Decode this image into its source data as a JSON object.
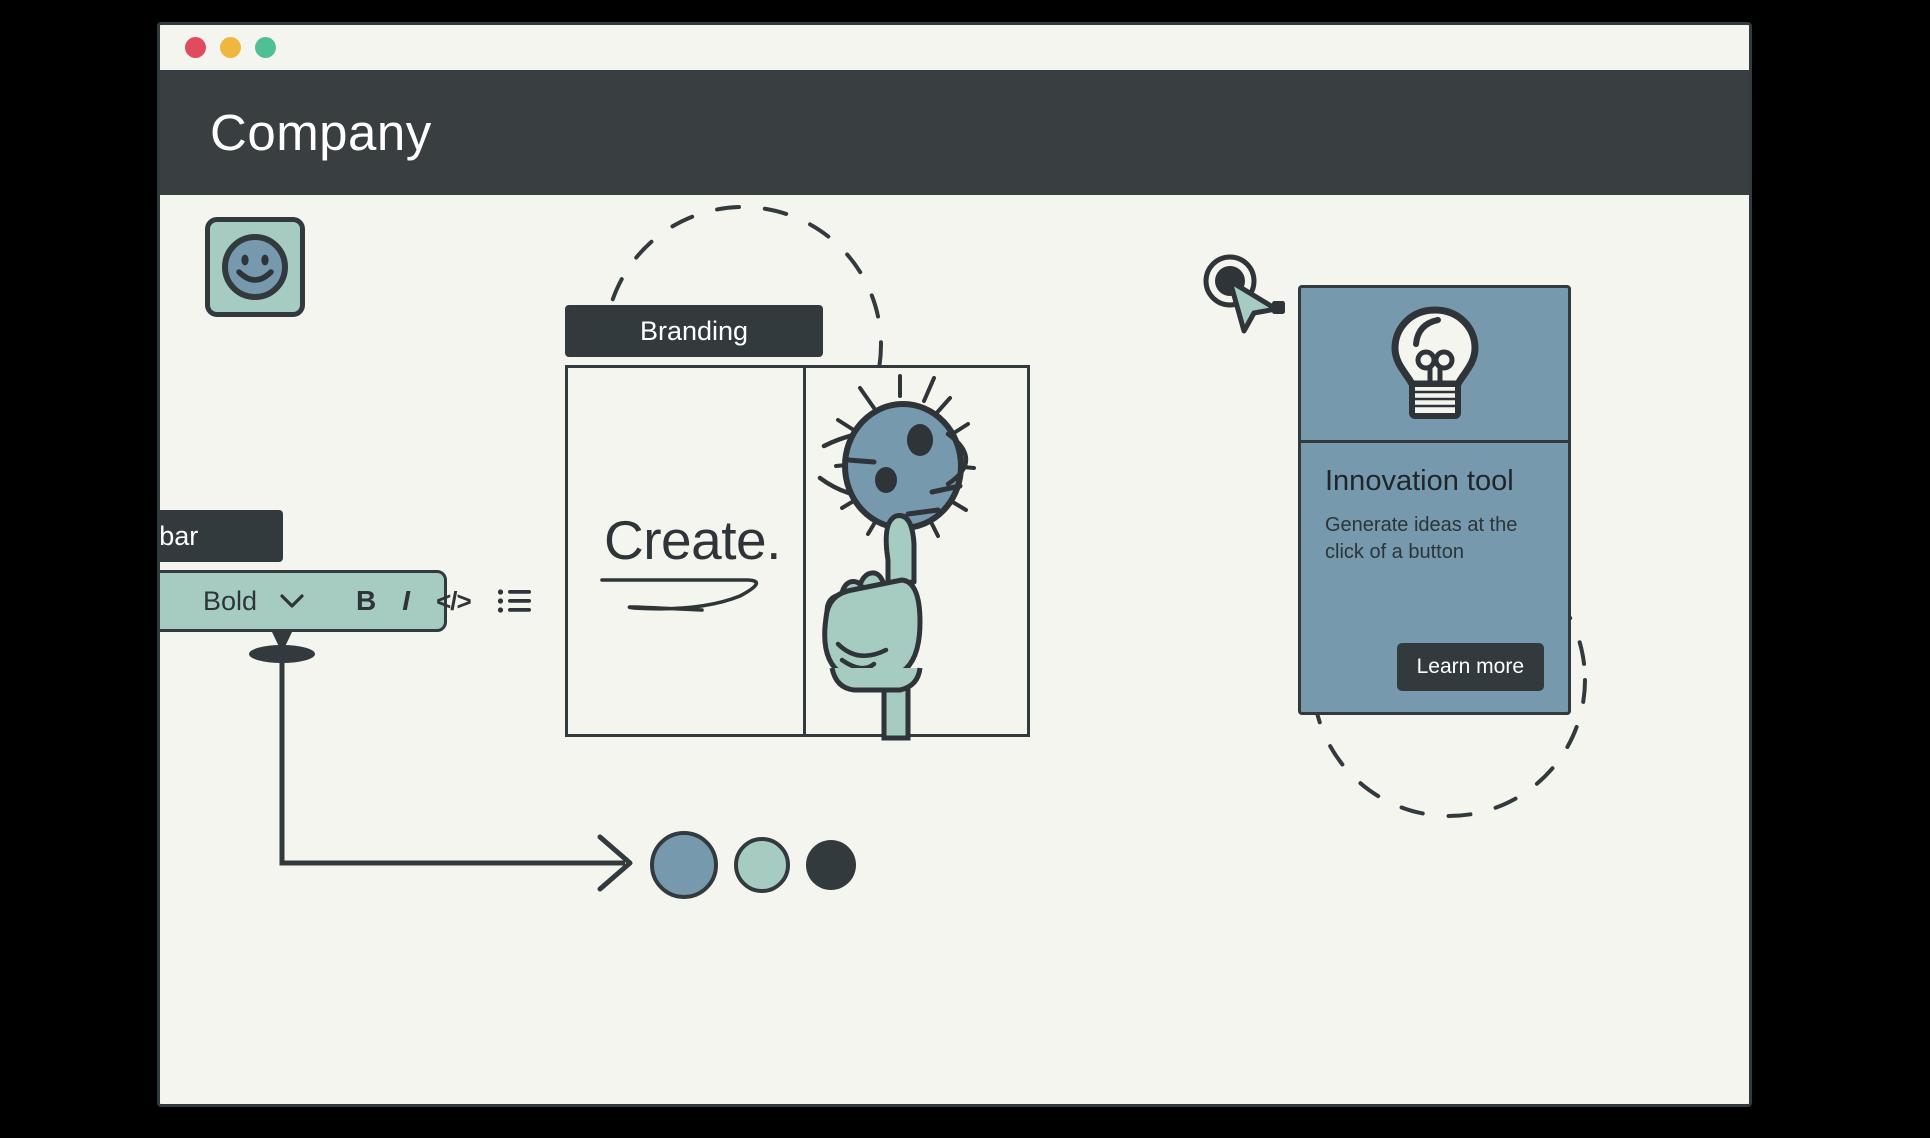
{
  "window": {
    "traffic_lights": [
      {
        "name": "close",
        "color": "#E04B5E"
      },
      {
        "name": "minimize",
        "color": "#F0B73F"
      },
      {
        "name": "maximize",
        "color": "#4FBF96"
      }
    ]
  },
  "header": {
    "title": "Company"
  },
  "app_icon": {
    "name": "smiley-face-icon"
  },
  "callouts": {
    "branding_label": "Branding",
    "toolbar_label": "Toolbar"
  },
  "toolbar": {
    "style_select": {
      "value": "Bold",
      "chevron": "chevron-down-icon"
    },
    "buttons": [
      {
        "name": "bold-button",
        "label": "B"
      },
      {
        "name": "italic-button",
        "label": "I"
      },
      {
        "name": "code-button",
        "label": "</>"
      },
      {
        "name": "bullet-list-button",
        "label": "bullet-list-icon"
      }
    ]
  },
  "brand_card": {
    "headline": "Create.",
    "illustration": "lightbulb-sun-pointing-hand-illustration"
  },
  "innovation_card": {
    "icon": "lightbulb-icon",
    "title": "Innovation tool",
    "description": "Generate ideas at the click of a button",
    "cta_label": "Learn more",
    "bg_color": "#7699AE"
  },
  "swatches": [
    {
      "name": "swatch-blue",
      "color": "#7699AE"
    },
    {
      "name": "swatch-mint",
      "color": "#A6CCC2"
    },
    {
      "name": "swatch-charcoal",
      "color": "#333A3D"
    }
  ],
  "cursor": {
    "name": "click-cursor-indicator"
  },
  "palette": {
    "page_bg": "#000000",
    "window_bg": "#F5F5F0",
    "header_bg": "#393E41",
    "ink": "#333A3D",
    "blue": "#7699AE",
    "mint": "#A6CCC2"
  }
}
